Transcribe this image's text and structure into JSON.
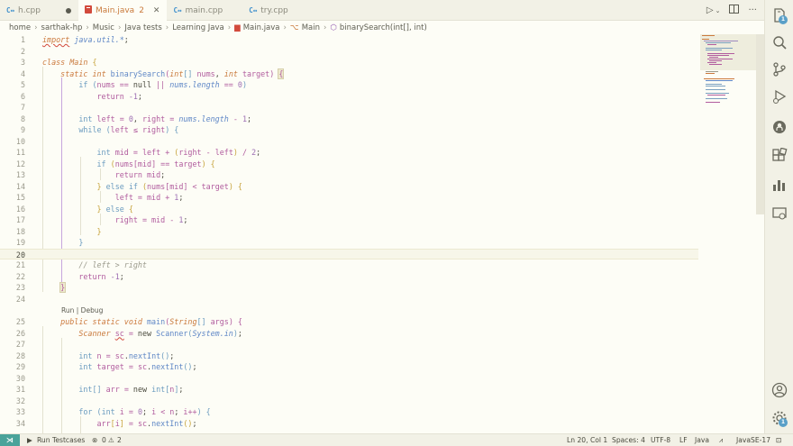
{
  "tabs": [
    {
      "label": "h.cpp",
      "icon": "C↔",
      "modified": true
    },
    {
      "label": "Main.java",
      "icon": "J",
      "badge": "2",
      "active": true
    },
    {
      "label": "main.cpp",
      "icon": "C↔"
    },
    {
      "label": "try.cpp",
      "icon": "C↔"
    }
  ],
  "breadcrumb": {
    "parts": [
      "home",
      "sarthak-hp",
      "Music",
      "Java tests",
      "Learning Java"
    ],
    "file": "Main.java",
    "class": "Main",
    "method": "binarySearch(int[], int)"
  },
  "editor": {
    "codelens": "Run | Debug",
    "line_numbers": [
      "1",
      "2",
      "3",
      "4",
      "5",
      "6",
      "7",
      "8",
      "9",
      "10",
      "11",
      "12",
      "13",
      "14",
      "15",
      "16",
      "17",
      "18",
      "19",
      "20",
      "21",
      "22",
      "23",
      "24",
      "25",
      "26",
      "27",
      "28",
      "29",
      "30",
      "31",
      "32",
      "33",
      "34"
    ],
    "current_line": "20",
    "lines": [
      "import java.util.*;",
      "",
      "class Main {",
      "    static int binarySearch(int[] nums, int target) {",
      "        if (nums == null || nums.length == 0)",
      "            return -1;",
      "",
      "        int left = 0, right = nums.length - 1;",
      "        while (left ≤ right) {",
      "",
      "            int mid = left + (right - left) / 2;",
      "            if (nums[mid] == target) {",
      "                return mid;",
      "            } else if (nums[mid] < target) {",
      "                left = mid + 1;",
      "            } else {",
      "                right = mid - 1;",
      "            }",
      "        }",
      "",
      "        // left > right",
      "        return -1;",
      "    }",
      "",
      "    public static void main(String[] args) {",
      "        Scanner sc = new Scanner(System.in);",
      "",
      "        int n = sc.nextInt();",
      "        int target = sc.nextInt();",
      "",
      "        int[] arr = new int[n];",
      "",
      "        for (int i = 0; i < n; i++) {",
      "            arr[i] = sc.nextInt();"
    ]
  },
  "activity": {
    "explorer_badge": "1",
    "settings_badge": "1"
  },
  "status": {
    "run_testcases": "Run Testcases",
    "errors": "0",
    "warnings": "2",
    "position": "Ln 20, Col 1",
    "spaces": "Spaces: 4",
    "encoding": "UTF-8",
    "eol": "LF",
    "language": "Java",
    "java_version": "JavaSE-17"
  },
  "colors": {
    "accent": "#4aa39a",
    "keyword": "#6a9bbf",
    "type": "#c9793b",
    "function": "#5f87c6",
    "variable": "#b15c9e"
  }
}
